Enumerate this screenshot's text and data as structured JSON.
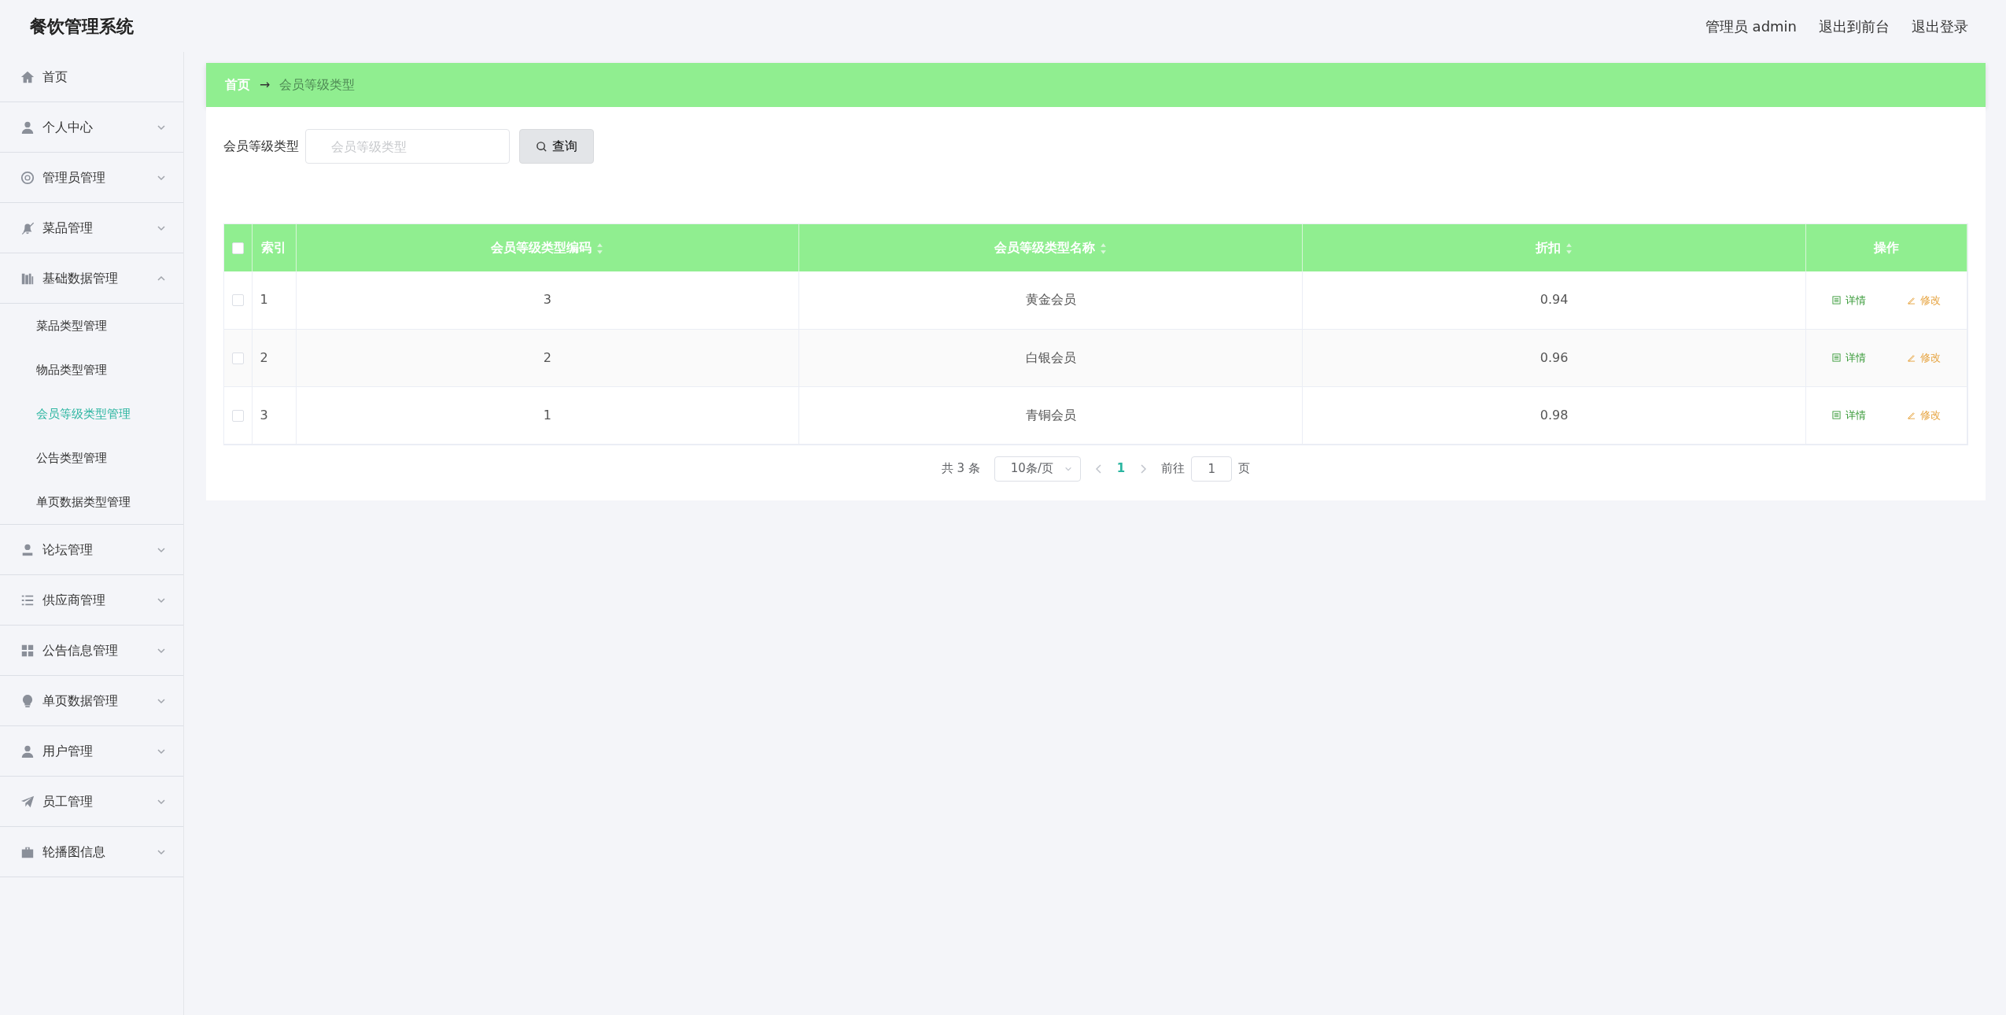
{
  "app_title": "餐饮管理系统",
  "header_links": [
    {
      "label": "管理员 admin"
    },
    {
      "label": "退出到前台"
    },
    {
      "label": "退出登录"
    }
  ],
  "sidebar": {
    "items": [
      {
        "label": "首页",
        "kind": "link"
      },
      {
        "label": "个人中心",
        "kind": "menu",
        "expanded": false
      },
      {
        "label": "管理员管理",
        "kind": "menu",
        "expanded": false
      },
      {
        "label": "菜品管理",
        "kind": "menu",
        "expanded": false
      },
      {
        "label": "基础数据管理",
        "kind": "menu",
        "expanded": true,
        "children": [
          {
            "label": "菜品类型管理",
            "selected": false
          },
          {
            "label": "物品类型管理",
            "selected": false
          },
          {
            "label": "会员等级类型管理",
            "selected": true
          },
          {
            "label": "公告类型管理",
            "selected": false
          },
          {
            "label": "单页数据类型管理",
            "selected": false
          }
        ]
      },
      {
        "label": "论坛管理",
        "kind": "menu",
        "expanded": false
      },
      {
        "label": "供应商管理",
        "kind": "menu",
        "expanded": false
      },
      {
        "label": "公告信息管理",
        "kind": "menu",
        "expanded": false
      },
      {
        "label": "单页数据管理",
        "kind": "menu",
        "expanded": false
      },
      {
        "label": "用户管理",
        "kind": "menu",
        "expanded": false
      },
      {
        "label": "员工管理",
        "kind": "menu",
        "expanded": false
      },
      {
        "label": "轮播图信息",
        "kind": "menu",
        "expanded": false
      }
    ]
  },
  "breadcrumb": [
    {
      "label": "首页"
    },
    {
      "label": "会员等级类型"
    }
  ],
  "breadcrumb_separator": "→",
  "search": {
    "label": "会员等级类型",
    "placeholder": "会员等级类型",
    "button": "查询"
  },
  "table": {
    "select_all_checked": false,
    "columns": [
      {
        "label": "索引",
        "sortable": false
      },
      {
        "label": "会员等级类型编码",
        "sortable": true
      },
      {
        "label": "会员等级类型名称",
        "sortable": true
      },
      {
        "label": "折扣",
        "sortable": true
      },
      {
        "label": "操作",
        "sortable": false
      }
    ],
    "rows": [
      {
        "checked": false,
        "index": "1",
        "code": "3",
        "name": "黄金会员",
        "discount": "0.94",
        "actions": [
          {
            "kind": "detail",
            "label": "详情"
          },
          {
            "kind": "edit",
            "label": "修改"
          }
        ]
      },
      {
        "checked": false,
        "index": "2",
        "code": "2",
        "name": "白银会员",
        "discount": "0.96",
        "actions": [
          {
            "kind": "detail",
            "label": "详情"
          },
          {
            "kind": "edit",
            "label": "修改"
          }
        ]
      },
      {
        "checked": false,
        "index": "3",
        "code": "1",
        "name": "青铜会员",
        "discount": "0.98",
        "actions": [
          {
            "kind": "detail",
            "label": "详情"
          },
          {
            "kind": "edit",
            "label": "修改"
          }
        ]
      }
    ]
  },
  "pagination": {
    "total": "共 3 条",
    "page_size": "10条/页",
    "pages": [
      {
        "label": "1",
        "selected": true
      }
    ],
    "goto_label": "前往",
    "goto_value": "1",
    "goto_suffix": "页"
  }
}
